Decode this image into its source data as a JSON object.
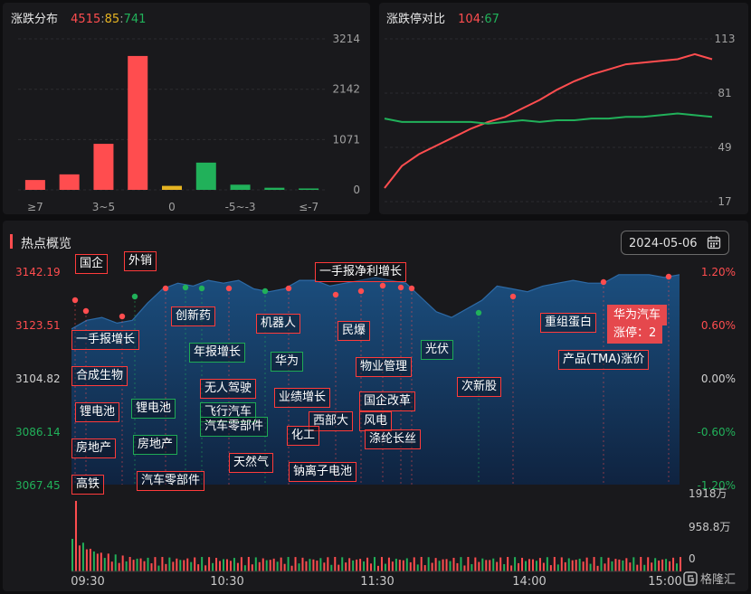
{
  "top_left": {
    "title": "涨跌分布",
    "up": "4515",
    "sep1": ":",
    "flat": "85",
    "sep2": ":",
    "down": "741"
  },
  "top_right": {
    "title": "涨跌停对比",
    "limit_up": "104",
    "sep": ":",
    "limit_down": "67"
  },
  "main": {
    "title": "热点概览",
    "date": "2024-05-06"
  },
  "watermark": "格隆汇",
  "colors": {
    "up": "#ff4d4f",
    "down": "#21b15a",
    "flat": "#e6b422",
    "bg": "#19191c"
  },
  "chart_data": [
    {
      "type": "bar",
      "categories": [
        "≥7",
        "",
        "3~5",
        "",
        "0",
        "",
        "-5~-3",
        "",
        "≤-7"
      ],
      "visible_tick_labels": [
        "≥7",
        "3~5",
        "0",
        "-5~-3",
        "≤-7"
      ],
      "values": [
        210,
        330,
        980,
        2850,
        85,
        580,
        110,
        45,
        30
      ],
      "ylim": [
        0,
        3214
      ],
      "yticks": [
        0,
        1071,
        2142,
        3214
      ]
    },
    {
      "type": "line",
      "yticks": [
        17,
        49,
        81,
        113
      ],
      "ylim": [
        17,
        113
      ],
      "series": [
        {
          "values": [
            25,
            38,
            45,
            50,
            55,
            60,
            64,
            67,
            72,
            77,
            83,
            88,
            92,
            95,
            98,
            99,
            100,
            101,
            104,
            101
          ]
        },
        {
          "values": [
            66,
            64,
            64,
            64,
            64,
            64,
            63,
            64,
            65,
            64,
            65,
            65,
            66,
            66,
            67,
            67,
            68,
            69,
            68,
            67
          ]
        }
      ]
    },
    {
      "type": "area",
      "left_yticks": [
        "3142.19",
        "3123.51",
        "3104.82",
        "3086.14",
        "3067.45"
      ],
      "right_yticks": [
        "1.20%",
        "0.60%",
        "0.00%",
        "-0.60%",
        "-1.20%"
      ],
      "volume_yticks": [
        "1918万",
        "958.8万",
        "0"
      ],
      "xticks": [
        "09:30",
        "10:30",
        "11:30",
        "14:00",
        "15:00"
      ],
      "ylim": [
        3067.45,
        3142.19
      ],
      "series": [
        {
          "values": [
            3122,
            3125,
            3126,
            3124,
            3125,
            3131,
            3136,
            3138,
            3137,
            3139,
            3138,
            3139,
            3136,
            3135,
            3136,
            3139,
            3139,
            3137,
            3138,
            3139,
            3140,
            3139,
            3138,
            3133,
            3128,
            3126,
            3129,
            3132,
            3137,
            3136,
            3135,
            3137,
            3138,
            3139,
            3138,
            3138,
            3141,
            3141,
            3141,
            3140,
            3141
          ]
        }
      ]
    }
  ],
  "tags": [
    {
      "text": "国企",
      "kind": "r"
    },
    {
      "text": "外销",
      "kind": "r"
    },
    {
      "text": "一手报净利增长",
      "kind": "r"
    },
    {
      "text": "创新药",
      "kind": "r"
    },
    {
      "text": "机器人",
      "kind": "r"
    },
    {
      "text": "民爆",
      "kind": "r"
    },
    {
      "text": "重组蛋白",
      "kind": "r"
    },
    {
      "text": "华为汽车",
      "kind": "hl"
    },
    {
      "text": "涨停：2",
      "kind": "hl"
    },
    {
      "text": "一手报增长",
      "kind": "r"
    },
    {
      "text": "年报增长",
      "kind": "g"
    },
    {
      "text": "光伏",
      "kind": "g"
    },
    {
      "text": "华为",
      "kind": "g"
    },
    {
      "text": "物业管理",
      "kind": "r"
    },
    {
      "text": "产品(TMA)涨价",
      "kind": "r"
    },
    {
      "text": "合成生物",
      "kind": "r"
    },
    {
      "text": "无人驾驶",
      "kind": "r"
    },
    {
      "text": "次新股",
      "kind": "r"
    },
    {
      "text": "业绩增长",
      "kind": "r"
    },
    {
      "text": "国企改革",
      "kind": "r"
    },
    {
      "text": "锂电池",
      "kind": "r"
    },
    {
      "text": "锂电池",
      "kind": "g"
    },
    {
      "text": "飞行汽车",
      "kind": "g"
    },
    {
      "text": "汽车零部件",
      "kind": "g"
    },
    {
      "text": "西部大",
      "kind": "r"
    },
    {
      "text": "风电",
      "kind": "r"
    },
    {
      "text": "化工",
      "kind": "r"
    },
    {
      "text": "房地产",
      "kind": "r"
    },
    {
      "text": "房地产",
      "kind": "g"
    },
    {
      "text": "涤纶长丝",
      "kind": "r"
    },
    {
      "text": "天然气",
      "kind": "r"
    },
    {
      "text": "钠离子电池",
      "kind": "r"
    },
    {
      "text": "高铁",
      "kind": "r"
    },
    {
      "text": "汽车零部件",
      "kind": "r"
    }
  ]
}
